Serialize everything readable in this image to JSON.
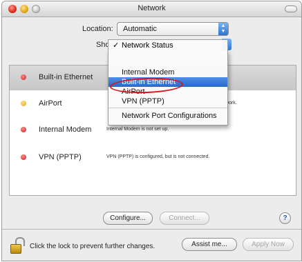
{
  "window": {
    "title": "Network"
  },
  "location": {
    "label": "Location:",
    "value": "Automatic"
  },
  "show": {
    "label": "Show"
  },
  "show_menu": {
    "selected": "Network Status",
    "items": [
      {
        "label": "Internal Modem"
      },
      {
        "label": "Built-in Ethernet"
      },
      {
        "label": "AirPort"
      },
      {
        "label": "VPN (PPTP)"
      }
    ],
    "extra": "Network Port Configurations"
  },
  "services": [
    {
      "name": "Built-in Ethernet",
      "status": "",
      "status_color": "#d21a1a"
    },
    {
      "name": "AirPort",
      "status": "twork.",
      "status_color": "#e3a315"
    },
    {
      "name": "Internal Modem",
      "status": "Internal Modem is not set up.",
      "status_color": "#d21a1a"
    },
    {
      "name": "VPN (PPTP)",
      "status": "VPN (PPTP) is configured, but is not connected.",
      "status_color": "#d21a1a"
    }
  ],
  "buttons": {
    "configure": "Configure...",
    "connect": "Connect...",
    "assist": "Assist me...",
    "apply": "Apply Now",
    "help": "?"
  },
  "lock": {
    "text": "Click the lock to prevent further changes."
  },
  "icons": {
    "lock": "lock-icon",
    "help": "help-icon",
    "status_dot": "status-dot-icon"
  },
  "colors": {
    "highlight": "#2a69c8",
    "annotation": "#d8141e"
  }
}
